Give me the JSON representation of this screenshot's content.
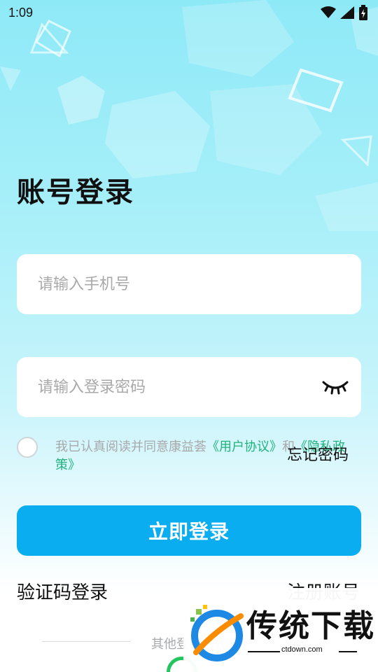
{
  "status_bar": {
    "time": "1:09"
  },
  "page_title": "账号登录",
  "phone_field": {
    "placeholder": "请输入手机号",
    "value": ""
  },
  "password_field": {
    "placeholder": "请输入登录密码",
    "value": ""
  },
  "agreement": {
    "prefix": "我已认真阅读并同意康益荟",
    "user_agreement": "《用户协议》",
    "conjunction": "和",
    "privacy_policy": "《隐私政策》"
  },
  "forgot_password": "忘记密码",
  "login_button": "立即登录",
  "sms_login": "验证码登录",
  "register": "注册账号",
  "other_login": "其他登录方式",
  "watermark": {
    "brand": "传统下载",
    "url": "ctdown.com"
  },
  "colors": {
    "accent": "#0aaef0",
    "link": "#1fb37b",
    "bg_top": "#8ee9f7"
  }
}
